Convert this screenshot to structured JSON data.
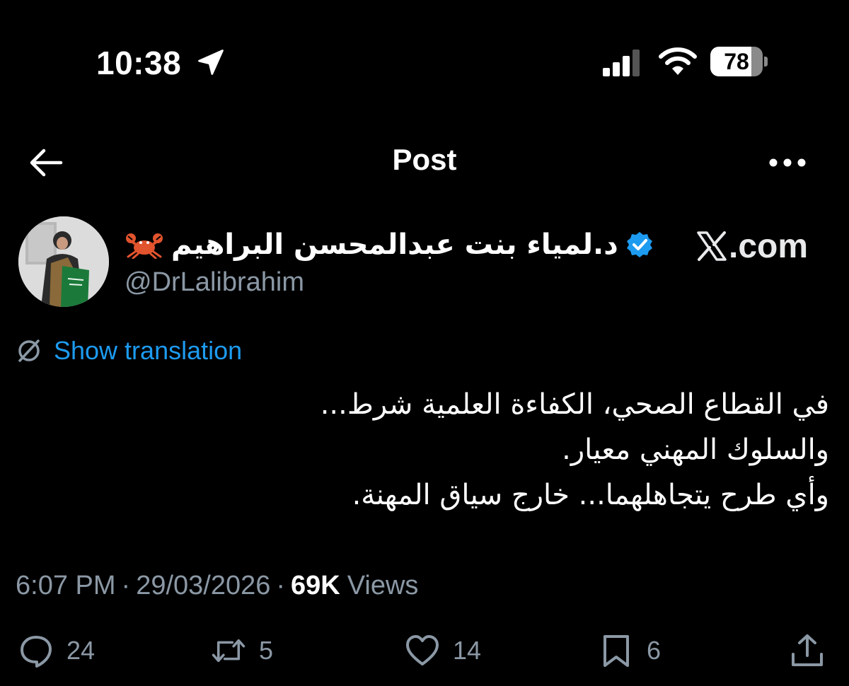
{
  "status_bar": {
    "time": "10:38",
    "battery_level": "78",
    "battery_fraction": 0.78
  },
  "nav": {
    "title": "Post"
  },
  "author": {
    "display_name": "د.لمياء بنت عبدالمحسن البراهيم",
    "handle": "@DrLalibrahim",
    "verified": true,
    "name_emoji": "crab-icon"
  },
  "watermark": {
    "text": ".com",
    "logo": "x-logo-icon"
  },
  "translation": {
    "label": "Show translation"
  },
  "tweet": {
    "lines": [
      "في القطاع الصحي، الكفاءة العلمية شرط...",
      "والسلوك المهني معيار.",
      "وأي طرح يتجاهلهما... خارج سياق المهنة."
    ]
  },
  "meta": {
    "time": "6:07 PM",
    "date": "29/03/2026",
    "views_count": "69K",
    "views_label": "Views",
    "separator": "·"
  },
  "actions": {
    "replies": "24",
    "reposts": "5",
    "likes": "14",
    "bookmarks": "6"
  },
  "colors": {
    "background": "#000000",
    "link": "#1d9bf0",
    "secondary_text": "#8b98a5",
    "verified_badge": "#1d9bf0"
  }
}
